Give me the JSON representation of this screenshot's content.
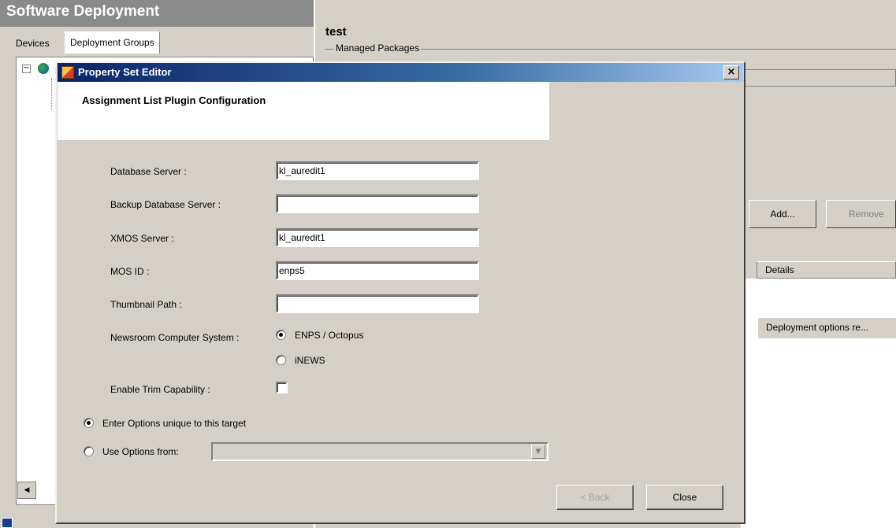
{
  "app": {
    "title": "Software Deployment",
    "tabs": [
      "Devices",
      "Deployment Groups"
    ]
  },
  "right": {
    "title": "test",
    "group_label": "Managed Packages",
    "add_label": "Add...",
    "remove_label": "Remove",
    "details_header": "Details",
    "deploy_row": "Deployment options re..."
  },
  "dialog": {
    "title": "Property Set Editor",
    "close_glyph": "×",
    "banner_title": "Assignment List Plugin Configuration",
    "fields": {
      "database_server_label": "Database Server :",
      "database_server_value": "kl_auredit1",
      "backup_server_label": "Backup Database Server :",
      "backup_server_value": "",
      "xmos_label": "XMOS Server :",
      "xmos_value": "kl_auredit1",
      "mosid_label": "MOS ID :",
      "mosid_value": "enps5",
      "thumbnail_label": "Thumbnail Path :",
      "thumbnail_value": ""
    },
    "ncs": {
      "label": "Newsroom Computer System :",
      "option_enps": "ENPS / Octopus",
      "option_inews": "iNEWS",
      "selected": "ENPS / Octopus"
    },
    "trim": {
      "label": "Enable Trim Capability :",
      "checked": false
    },
    "target_options": {
      "unique_label": "Enter Options unique to this target",
      "use_from_label": "Use Options from:",
      "selected": "unique"
    },
    "buttons": {
      "back": "< Back",
      "close": "Close"
    }
  },
  "colors": {
    "titlebar_start": "#0a246a",
    "titlebar_end": "#a6caf0",
    "app_header": "#8a8a8a",
    "window_bg": "#d4d0c8"
  }
}
